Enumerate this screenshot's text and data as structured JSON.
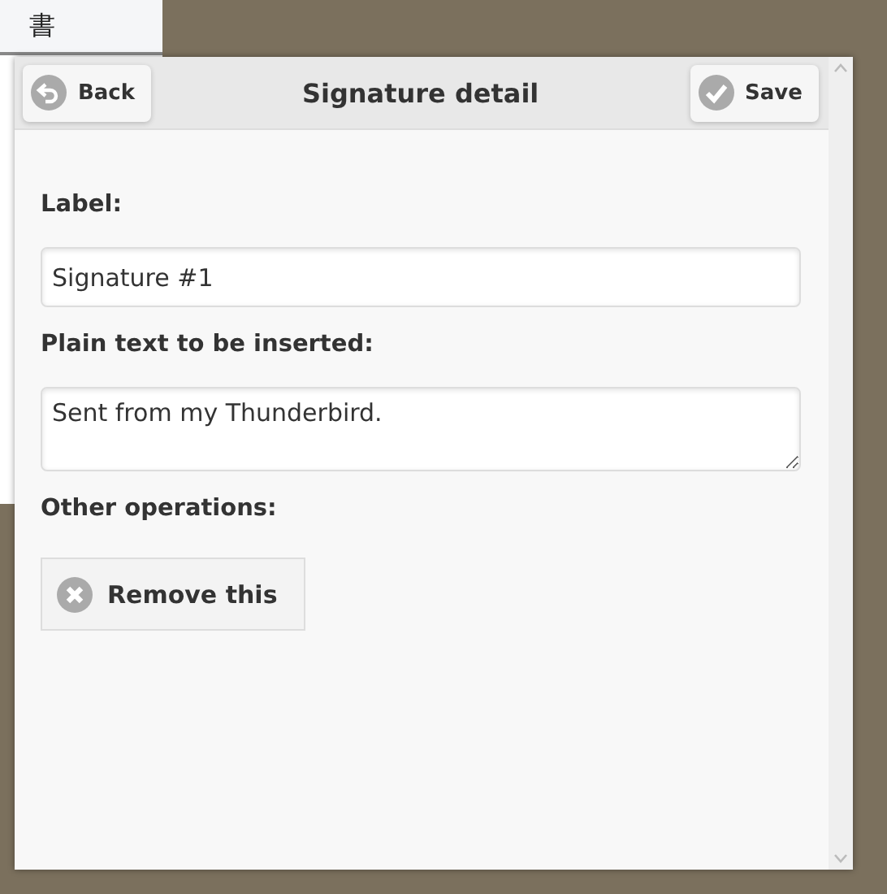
{
  "background_window": {
    "toolbar_button": "書"
  },
  "dialog": {
    "title": "Signature detail",
    "back_button": "Back",
    "save_button": "Save",
    "fields": [
      {
        "kind": "input",
        "label": "Label:",
        "value": "Signature #1"
      },
      {
        "kind": "textarea",
        "label": "Plain text to be inserted:",
        "value": "Sent from my Thunderbird."
      }
    ],
    "operations_label": "Other operations:",
    "remove_button": "Remove this"
  }
}
